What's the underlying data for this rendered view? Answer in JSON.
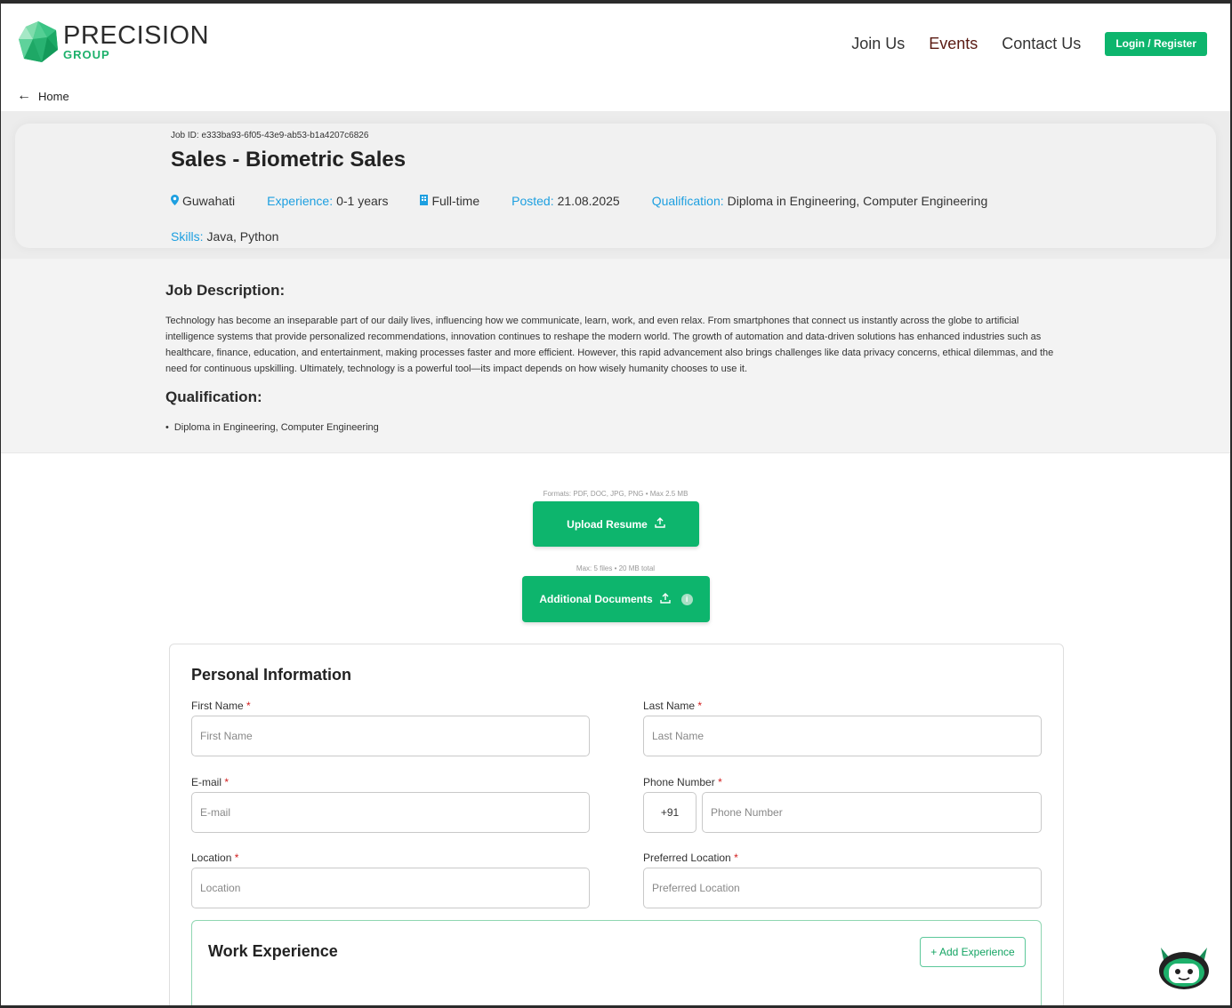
{
  "brand": {
    "name": "PRECISION",
    "sub": "GROUP",
    "accent": "#0db56d"
  },
  "nav": {
    "items": [
      "Join Us",
      "Events",
      "Contact Us"
    ],
    "login_label": "Login / Register"
  },
  "breadcrumb": {
    "label": "Home"
  },
  "job": {
    "id_text": "Job ID: e333ba93-6f05-43e9-ab53-b1a4207c6826",
    "title": "Sales - Biometric Sales",
    "location": "Guwahati",
    "experience_label": "Experience:",
    "experience_value": "0-1 years",
    "type": "Full-time",
    "posted_label": "Posted:",
    "posted_value": "21.08.2025",
    "qualification_label": "Qualification:",
    "qualification_value": "Diploma in Engineering, Computer Engineering",
    "skills_label": "Skills:",
    "skills_value": "Java, Python"
  },
  "description": {
    "heading": "Job Description:",
    "text": "Technology has become an inseparable part of our daily lives, influencing how we communicate, learn, work, and even relax. From smartphones that connect us instantly across the globe to artificial intelligence systems that provide personalized recommendations, innovation continues to reshape the modern world. The growth of automation and data-driven solutions has enhanced industries such as healthcare, finance, education, and entertainment, making processes faster and more efficient. However, this rapid advancement also brings challenges like data privacy concerns, ethical dilemmas, and the need for continuous upskilling. Ultimately, technology is a powerful tool—its impact depends on how wisely humanity chooses to use it.",
    "qualification_heading": "Qualification:",
    "qualification_items": [
      "Diploma in Engineering, Computer Engineering"
    ]
  },
  "upload": {
    "resume_note": "Formats: PDF, DOC, JPG, PNG • Max 2.5 MB",
    "resume_label": "Upload Resume",
    "docs_note": "Max: 5 files • 20 MB total",
    "docs_label": "Additional Documents"
  },
  "form": {
    "title": "Personal Information",
    "first_name": {
      "label": "First Name",
      "placeholder": "First Name"
    },
    "last_name": {
      "label": "Last Name",
      "placeholder": "Last Name"
    },
    "email": {
      "label": "E-mail",
      "placeholder": "E-mail"
    },
    "phone": {
      "label": "Phone Number",
      "code": "+91",
      "placeholder": "Phone Number"
    },
    "location": {
      "label": "Location",
      "placeholder": "Location"
    },
    "preferred_location": {
      "label": "Preferred Location",
      "placeholder": "Preferred Location"
    },
    "required_mark": "*"
  },
  "work": {
    "title": "Work Experience",
    "add_label": "+ Add Experience"
  }
}
